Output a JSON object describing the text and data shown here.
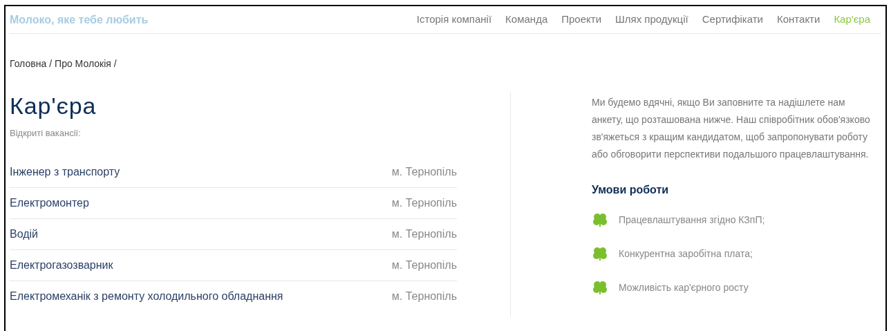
{
  "brand": "Молоко, яке тебе любить",
  "nav": [
    {
      "label": "Історія компанії",
      "selected": false
    },
    {
      "label": "Команда",
      "selected": false
    },
    {
      "label": "Проекти",
      "selected": false
    },
    {
      "label": "Шлях продукції",
      "selected": false
    },
    {
      "label": "Сертифікати",
      "selected": false
    },
    {
      "label": "Контакти",
      "selected": false
    },
    {
      "label": "Кар'єра",
      "selected": true
    }
  ],
  "breadcrumb": [
    "Головна",
    "/",
    "Про Молокія",
    "/"
  ],
  "title": "Кар'єра",
  "subtitle": "Відкриті вакансії:",
  "vacancies": [
    {
      "position": "Інженер з транспорту",
      "city": "м. Тернопіль"
    },
    {
      "position": "Електромонтер",
      "city": "м. Тернопіль"
    },
    {
      "position": "Водій",
      "city": "м. Тернопіль"
    },
    {
      "position": "Електрогазозварник",
      "city": "м. Тернопіль"
    },
    {
      "position": "Електромеханік з ремонту холодильного обладнання",
      "city": "м. Тернопіль"
    }
  ],
  "intro": "Ми будемо вдячні, якщо Ви заповните та надішлете нам анкету, що розташована нижче. Наш співробітник обов'язково зв'яжеться з кращим кандидатом, щоб запропонувати роботу або обговорити перспективи подальшого працевлаштування.",
  "conditions_title": "Умови роботи",
  "conditions": [
    "Працевлаштування згідно КЗпП;",
    "Конкурентна заробітна плата;",
    "Можливість кар'єрного росту"
  ]
}
